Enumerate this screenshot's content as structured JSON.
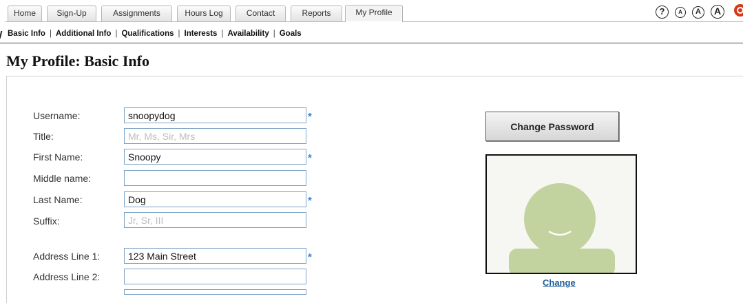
{
  "tabs": [
    {
      "label": "Home",
      "active": false
    },
    {
      "label": "Sign-Up",
      "active": false
    },
    {
      "label": "Assignments",
      "active": false
    },
    {
      "label": "Hours Log",
      "active": false
    },
    {
      "label": "Contact",
      "active": false
    },
    {
      "label": "Reports",
      "active": false
    },
    {
      "label": "My Profile",
      "active": true
    }
  ],
  "access_icons": [
    {
      "name": "help-icon",
      "glyph": "?"
    },
    {
      "name": "text-size-small-icon",
      "glyph": "A"
    },
    {
      "name": "text-size-medium-icon",
      "glyph": "A"
    },
    {
      "name": "text-size-large-icon",
      "glyph": "A"
    },
    {
      "name": "logout-power-icon"
    }
  ],
  "subnav": [
    "Basic Info",
    "Additional Info",
    "Qualifications",
    "Interests",
    "Availability",
    "Goals"
  ],
  "subnav_separator": "|",
  "page_title": "My Profile: Basic Info",
  "form": {
    "required_marker": "*",
    "fields": [
      {
        "label": "Username:",
        "value": "snoopydog",
        "placeholder": "",
        "required": true
      },
      {
        "label": "Title:",
        "value": "",
        "placeholder": "Mr, Ms, Sir, Mrs",
        "required": false
      },
      {
        "label": "First Name:",
        "value": "Snoopy",
        "placeholder": "",
        "required": true
      },
      {
        "label": "Middle name:",
        "value": "",
        "placeholder": "",
        "required": false
      },
      {
        "label": "Last Name:",
        "value": "Dog",
        "placeholder": "",
        "required": true
      },
      {
        "label": "Suffix:",
        "value": "",
        "placeholder": "Jr, Sr, III",
        "required": false
      },
      {
        "label": "Address Line 1:",
        "value": "123 Main Street",
        "placeholder": "",
        "required": true
      },
      {
        "label": "Address Line 2:",
        "value": "",
        "placeholder": "",
        "required": false
      }
    ]
  },
  "change_password_label": "Change Password",
  "photo_change_label": "Change",
  "colors": {
    "accent_blue": "#3a82d0",
    "link_blue": "#1f5c99",
    "avatar_green": "#c2d3a0",
    "power_red": "#d63a16"
  }
}
